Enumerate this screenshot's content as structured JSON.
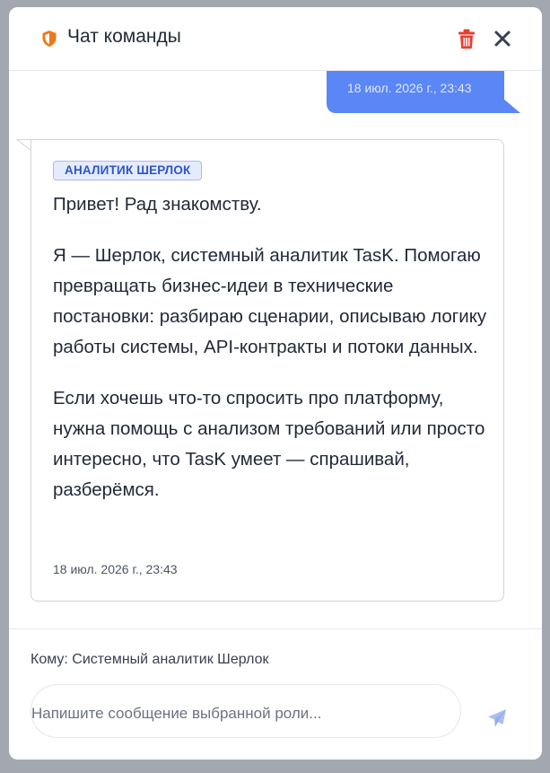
{
  "header": {
    "title": "Чат команды",
    "shield_icon": "shield-icon",
    "delete_icon": "trash-icon",
    "close_icon": "close-icon"
  },
  "messages": {
    "outgoing": {
      "timestamp": "18 июл. 2026 г., 23:43"
    },
    "incoming": {
      "role_badge": "АНАЛИТИК ШЕРЛОК",
      "paragraphs": [
        "Привет! Рад знакомству.",
        "Я — Шерлок, системный аналитик TasK. Помогаю превращать бизнес-идеи в технические постановки: разбираю сценарии, описываю логику работы системы, API-контракты и потоки данных.",
        "Если хочешь что-то спросить про платформу, нужна помощь с анализом требований или просто интересно, что TasK умеет — спрашивай, разберёмся."
      ],
      "timestamp": "18 июл. 2026 г., 23:43"
    }
  },
  "composer": {
    "recipient_label": "Кому: Системный аналитик Шерлок",
    "placeholder": "Напишите сообщение выбранной роли...",
    "value": "",
    "send_icon": "send-icon"
  },
  "colors": {
    "accent_blue": "#5b86f6",
    "shield_orange": "#ea7a1a",
    "trash_red": "#e5402f",
    "badge_bg": "#e4ebfc",
    "badge_text": "#2f55c4"
  }
}
